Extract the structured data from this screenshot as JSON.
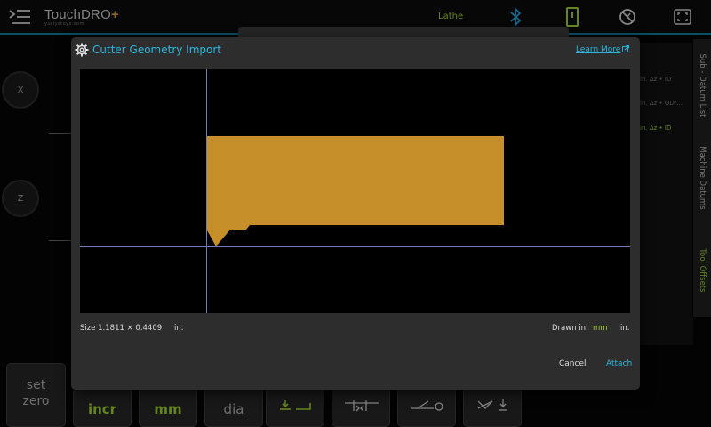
{
  "topbar": {
    "logo": "TouchDRO",
    "logo_plus": "+",
    "logo_tagline": "yuriystoys.com",
    "machine_type": "Lathe",
    "icons": [
      "menu-icon",
      "bluetooth-icon",
      "device-icon",
      "speed-off-icon",
      "fullscreen-icon"
    ],
    "accent_color": "#0b7a95"
  },
  "background": {
    "axes": [
      {
        "label": "X"
      },
      {
        "label": "Z"
      }
    ],
    "right_rows": [
      "in. Δz • ID",
      "in. Δz • OD/…",
      "in. Δz • ID"
    ],
    "side_tabs": [
      {
        "label": "Sub - Datum List",
        "active": false
      },
      {
        "label": "Machine Datums",
        "active": false
      },
      {
        "label": "Tool Offsets",
        "active": true
      }
    ],
    "bottom_keys": [
      {
        "line1": "set",
        "line2": "zero"
      },
      {
        "label": "incr"
      },
      {
        "label": "mm"
      },
      {
        "label": "dia"
      },
      {
        "icon": "tool-down-icon"
      },
      {
        "icon": "tool-width-icon"
      },
      {
        "icon": "tool-angle-icon"
      },
      {
        "icon": "tool-point-icon"
      }
    ]
  },
  "dialog": {
    "title": "Cutter Geometry Import",
    "learn_more": "Learn More",
    "size_label": "Size 1.1811 × 0.4409",
    "size_unit": "in.",
    "drawn_in_label": "Drawn in",
    "drawn_in_value": "mm",
    "target_unit": "in.",
    "cancel_label": "Cancel",
    "attach_label": "Attach",
    "shape_color": "#c68f2a",
    "crosshair_color": "#6d7fb5"
  }
}
